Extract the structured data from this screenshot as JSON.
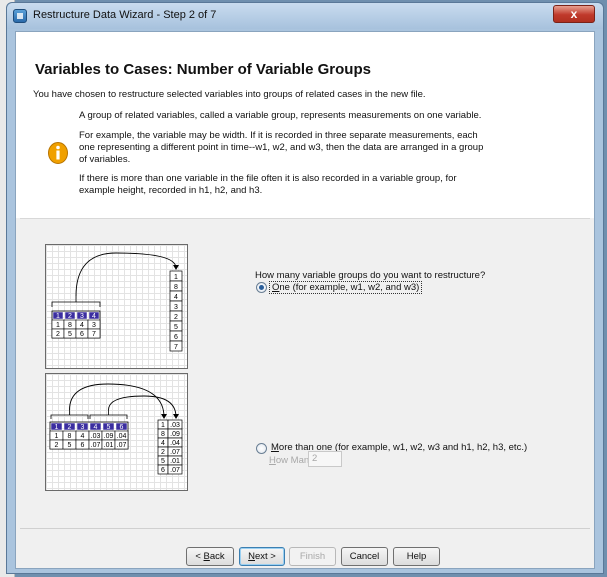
{
  "window": {
    "title": "Restructure Data Wizard - Step 2 of 7",
    "close_label": "x"
  },
  "header": {
    "heading": "Variables to Cases: Number of Variable Groups",
    "intro": "You have chosen to restructure selected variables into groups of related cases in the new file.",
    "para1": "A group of related variables, called a variable group, represents measurements on one variable.",
    "para2_line1": "For example, the variable may be width.  If it is recorded in three separate measurements, each",
    "para2_line2": "one representing a different point in time--w1, w2, and w3, then the data are arranged in a group",
    "para2_line3": "of variables.",
    "para3_line1": "If there is more than one variable in the file often it is also recorded in a variable group, for",
    "para3_line2": "example height, recorded in h1, h2, and h3."
  },
  "diagram_one": {
    "header": [
      "1",
      "2",
      "3",
      "4"
    ],
    "rows": [
      [
        "1",
        "8",
        "4",
        "3"
      ],
      [
        "2",
        "5",
        "6",
        "7"
      ]
    ],
    "column": [
      "1",
      "8",
      "4",
      "3",
      "2",
      "5",
      "6",
      "7"
    ]
  },
  "diagram_more": {
    "header": [
      "1",
      "2",
      "3",
      "4",
      "5",
      "6"
    ],
    "rows": [
      [
        "1",
        "8",
        "4",
        ".03",
        ".09",
        ".04"
      ],
      [
        "2",
        "5",
        "6",
        ".07",
        ".01",
        ".07"
      ]
    ],
    "column": [
      [
        "1",
        ".03"
      ],
      [
        "8",
        ".09"
      ],
      [
        "4",
        ".04"
      ],
      [
        "2",
        ".07"
      ],
      [
        "5",
        ".01"
      ],
      [
        "6",
        ".07"
      ]
    ]
  },
  "question": "How many variable groups do you want to restructure?",
  "options": {
    "one_prefix": "O",
    "one_rest": "ne (for example, w1, w2, and w3)",
    "more_prefix": "M",
    "more_rest": "ore than one (for example, w1, w2, w3 and h1, h2, h3, etc.)",
    "how_many_prefix": "H",
    "how_many_rest": "ow Many?",
    "how_many_value": "2",
    "selected": "one"
  },
  "buttons": {
    "back_prefix": "< ",
    "back_ul": "B",
    "back_rest": "ack",
    "next_ul": "N",
    "next_rest": "ext >",
    "finish": "Finish",
    "cancel": "Cancel",
    "help": "Help"
  },
  "colors": {
    "accent": "#3c7fb1",
    "header_cells": "#3b2ea0",
    "info_icon": "#f0a000"
  }
}
